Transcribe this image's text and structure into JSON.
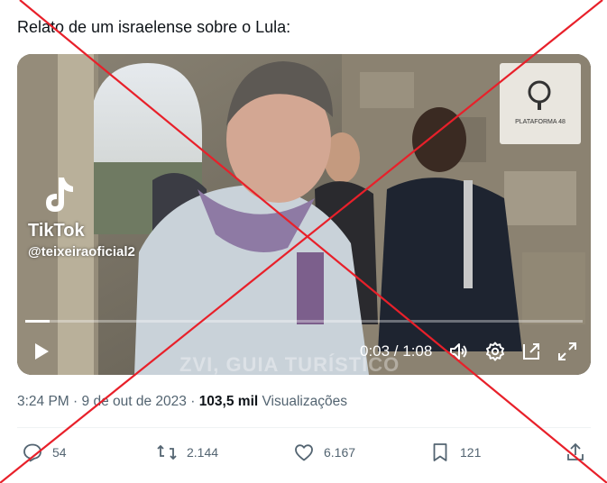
{
  "tweet": {
    "text": "Relato de um israelense sobre o Lula:"
  },
  "video": {
    "watermark_app": "TikTok",
    "watermark_handle": "@teixeiraoficial2",
    "sign_text": "PLATAFORMA 48",
    "caption": "ZVI, GUIA TURÍSTICO",
    "time_display": "0:03 / 1:08",
    "progress_fraction": 0.044
  },
  "meta": {
    "time": "3:24 PM",
    "separator": "·",
    "date": "9 de out de 2023",
    "views_count": "103,5 mil",
    "views_label": "Visualizações"
  },
  "actions": {
    "replies": "54",
    "retweets": "2.144",
    "likes": "6.167",
    "bookmarks": "121"
  },
  "colors": {
    "cross": "#e8202a",
    "secondary_text": "#536471"
  }
}
